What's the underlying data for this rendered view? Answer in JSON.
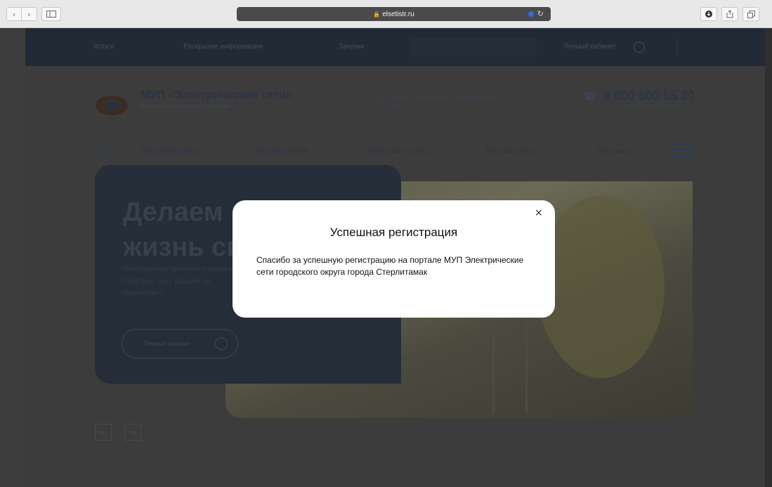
{
  "browser": {
    "url": "elsetistr.ru",
    "icons": {
      "back": "chevron-left-icon",
      "forward": "chevron-right-icon",
      "sidebar": "sidebar-icon",
      "download": "download-icon",
      "share": "share-icon",
      "tabs": "tabs-icon",
      "reload": "reload-icon",
      "lock": "lock-icon"
    }
  },
  "site": {
    "topbar": {
      "links": [
        "Услуги",
        "Раскрытие информации",
        "Закупки"
      ],
      "cabinet": "Личный кабинет"
    },
    "header": {
      "org_name": "МУП «Электрические сети»",
      "org_sub": "Городского округа города Стерлитамак",
      "address": "453126 г. Стерлитамак, ул. Шарбаняна 1а",
      "address_extra": "адрес",
      "phone": "8 800 500 55 30",
      "phone_sub": "единый контактный центр"
    },
    "menu": [
      "Потребителям",
      "Предприятие",
      "Обратная связь",
      "Вопрос-ответ",
      "Контакты"
    ],
    "hero": {
      "title_line1": "Делаем",
      "title_line2": "жизнь св",
      "text": "Повседневная практика п развитие структуры осна задания по разработке с",
      "button": "Личный кабинет"
    },
    "slider": {
      "prev": "←",
      "next": "→"
    },
    "colors": {
      "topbar": "#222a36",
      "hero_card": "#252d38",
      "overlay": "#3c3c3c"
    }
  },
  "modal": {
    "close": "×",
    "title": "Успешная регистрация",
    "text": "Спасибо за успешную регистрацию на портале МУП Электрические сети городского округа города Стерлитамак"
  }
}
